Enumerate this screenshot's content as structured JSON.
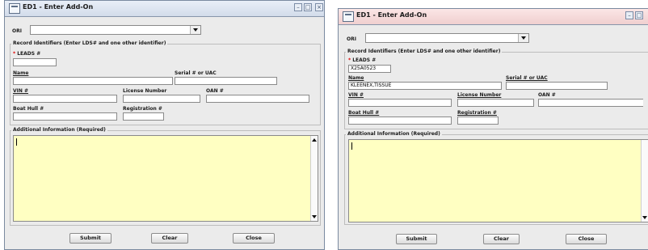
{
  "colors": {
    "left_titlebar": "#dde6f3",
    "right_titlebar": "#f7dada",
    "field_bg": "#ffffc2",
    "client_bg": "#ebebeb"
  },
  "dialogs": [
    {
      "title": "ED1 - Enter Add-On",
      "ori": {
        "label": "ORI",
        "value": ""
      },
      "record_group_title": "Record Identifiers (Enter LDS# and one other identifier)",
      "required_marker": "*",
      "leads": {
        "label": "LEADS #",
        "value": ""
      },
      "name": {
        "label": "Name",
        "value": ""
      },
      "serial": {
        "label": "Serial # or UAC",
        "value": ""
      },
      "vin": {
        "label": "VIN #",
        "value": ""
      },
      "license": {
        "label": "License Number",
        "value": ""
      },
      "oan": {
        "label": "OAN #",
        "value": ""
      },
      "boat_hull": {
        "label": "Boat Hull #",
        "value": ""
      },
      "registration": {
        "label": "Registration #",
        "value": ""
      },
      "additional_title": "Additional Information (Required)",
      "buttons": {
        "submit": "Submit",
        "clear": "Clear",
        "close": "Close"
      }
    },
    {
      "title": "ED1 - Enter Add-On",
      "ori": {
        "label": "ORI",
        "value": ""
      },
      "record_group_title": "Record Identifiers (Enter LDS# and one other identifier)",
      "required_marker": "*",
      "leads": {
        "label": "LEADS #",
        "value": "X25A0523"
      },
      "name": {
        "label": "Name",
        "value": "KLEENEX,TISSUE"
      },
      "serial": {
        "label": "Serial # or UAC",
        "value": ""
      },
      "vin": {
        "label": "VIN #",
        "value": ""
      },
      "license": {
        "label": "License Number",
        "value": ""
      },
      "oan": {
        "label": "OAN #",
        "value": ""
      },
      "boat_hull": {
        "label": "Boat Hull #",
        "value": ""
      },
      "registration": {
        "label": "Registration #",
        "value": ""
      },
      "additional_title": "Additional Information (Required)",
      "buttons": {
        "submit": "Submit",
        "clear": "Clear",
        "close": "Close"
      }
    }
  ]
}
